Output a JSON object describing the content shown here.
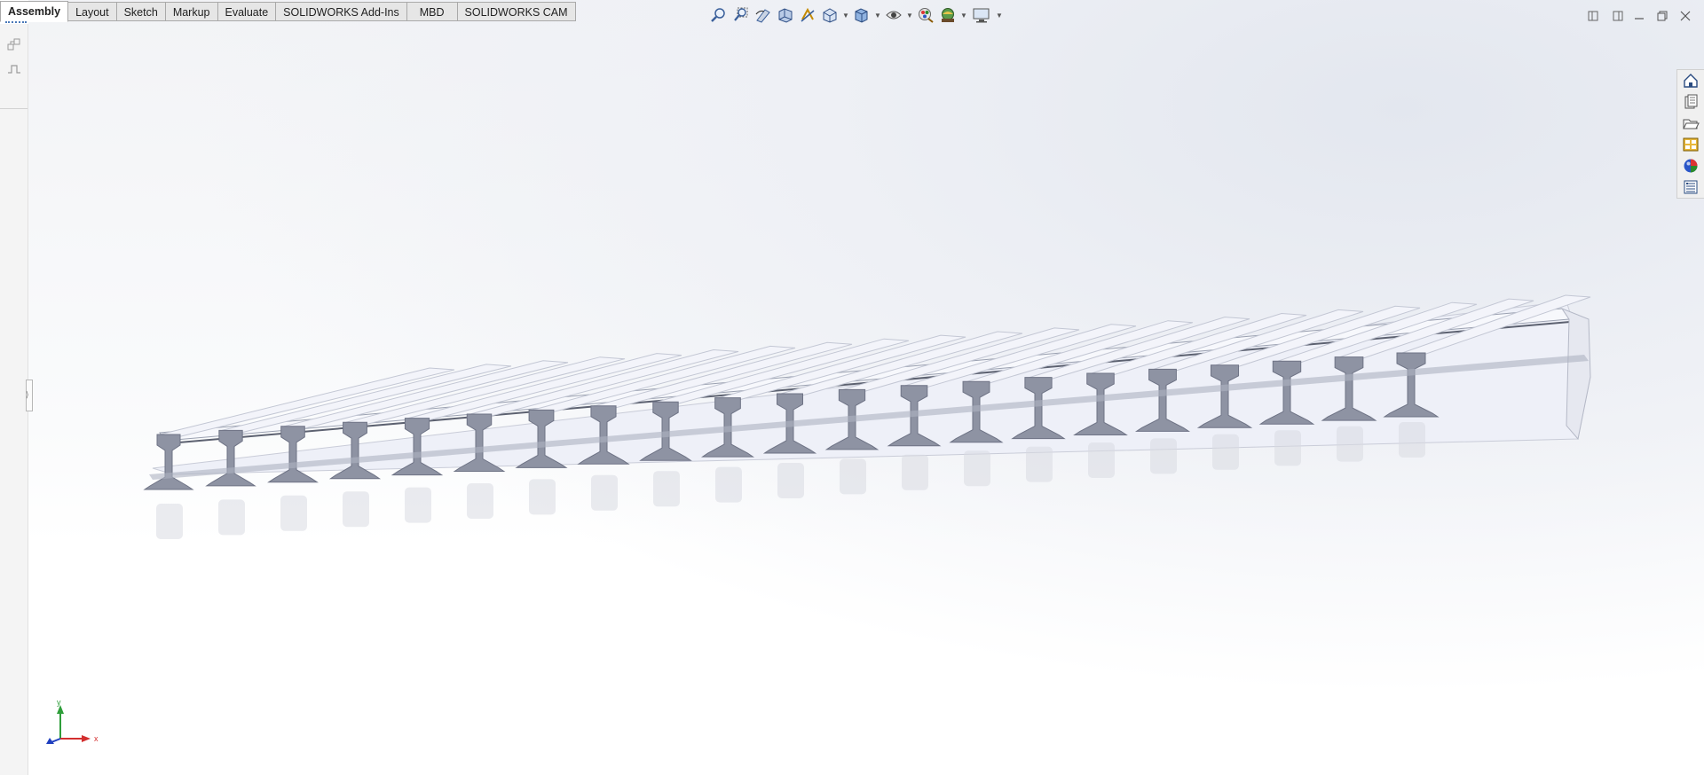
{
  "tabs": [
    {
      "label": "Assembly",
      "active": true
    },
    {
      "label": "Layout",
      "active": false
    },
    {
      "label": "Sketch",
      "active": false
    },
    {
      "label": "Markup",
      "active": false
    },
    {
      "label": "Evaluate",
      "active": false
    },
    {
      "label": "SOLIDWORKS Add-Ins",
      "active": false
    },
    {
      "label": "MBD",
      "active": false
    },
    {
      "label": "SOLIDWORKS CAM",
      "active": false
    }
  ],
  "heads_up_toolbar": [
    "zoom-to-fit-icon",
    "zoom-to-area-icon",
    "previous-view-icon",
    "section-view-icon",
    "dynamic-annotation-views-icon",
    "view-orientation-icon",
    "display-style-icon",
    "hide-show-items-icon",
    "edit-appearance-icon",
    "apply-scene-icon",
    "view-settings-icon"
  ],
  "window_controls": [
    "tile-left-icon",
    "tile-right-icon",
    "minimize-icon",
    "restore-icon",
    "close-icon"
  ],
  "task_pane": [
    "solidworks-resources-icon",
    "design-library-icon",
    "file-explorer-icon",
    "view-palette-icon",
    "appearances-scenes-icon",
    "custom-properties-icon"
  ],
  "triad": {
    "x_label": "x",
    "y_label": "y"
  },
  "model": {
    "rail_count": 21,
    "rail_color": "#8e93a3",
    "rail_face_color": "#eef0f8"
  },
  "colors": {
    "accent": "#4a78b8",
    "tab_bg": "#e6e6e6",
    "triad_x": "#d32f2f",
    "triad_y": "#2e9e3a",
    "triad_z": "#1f3fbf"
  }
}
